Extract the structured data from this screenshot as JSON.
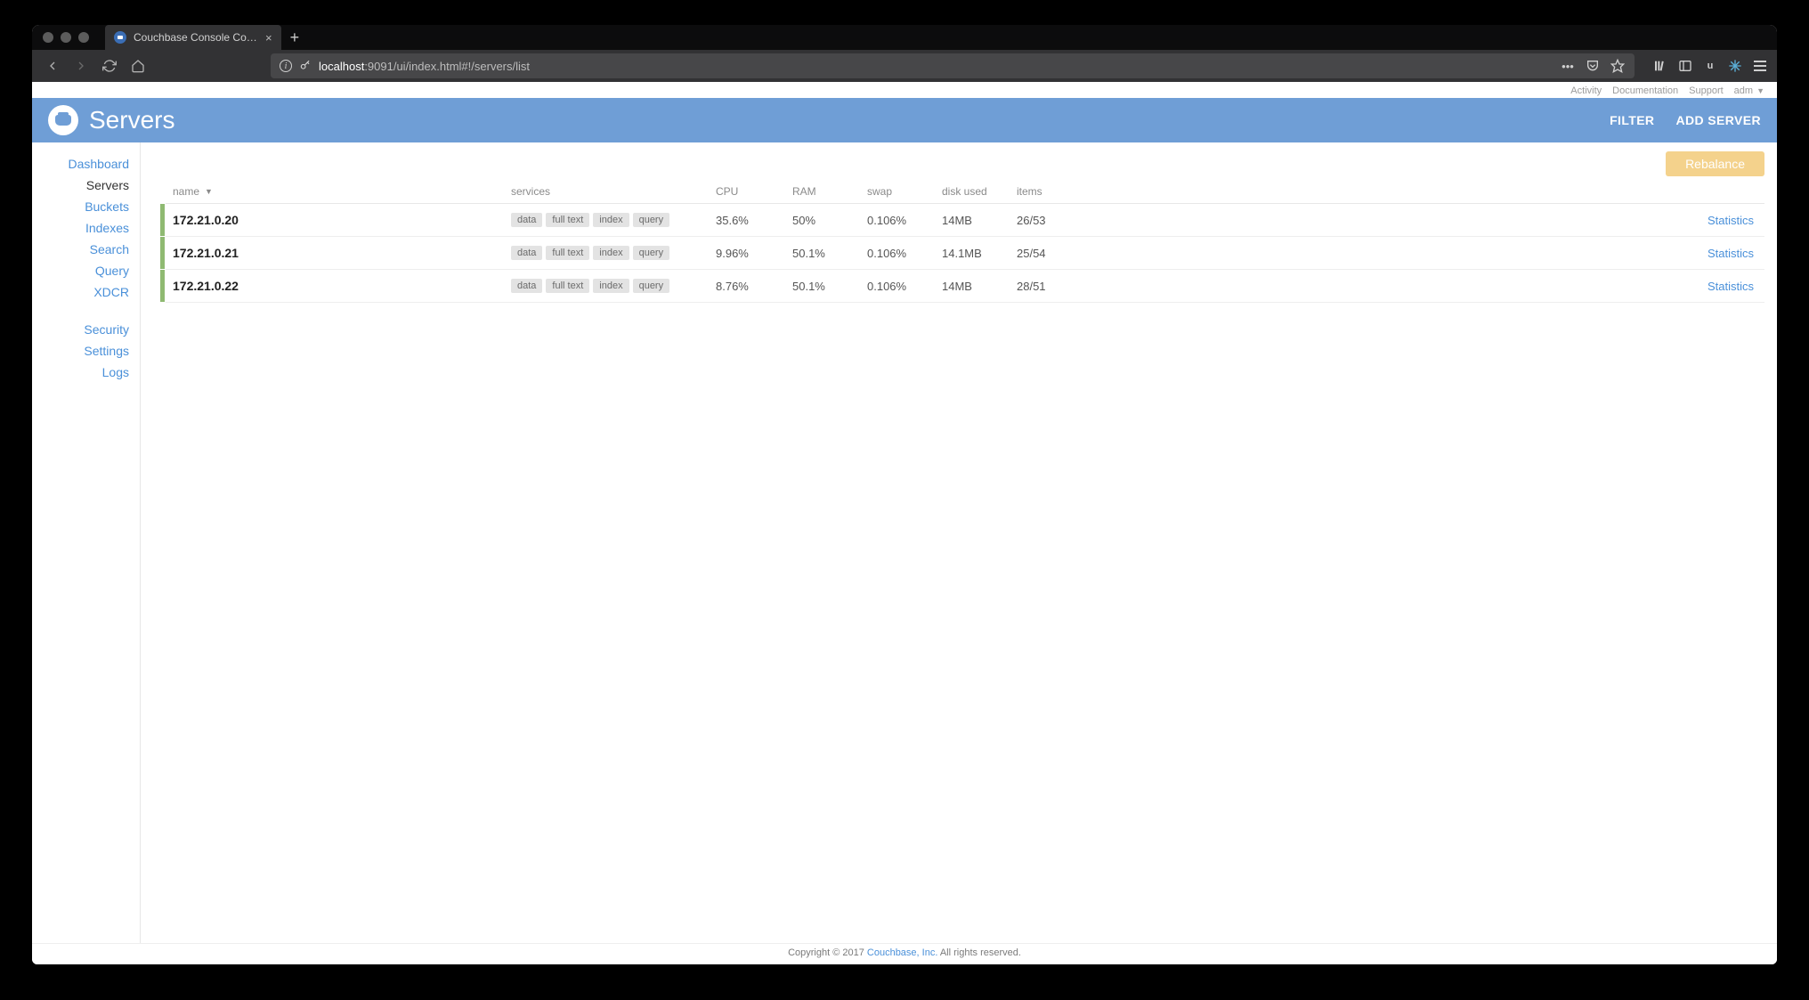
{
  "browser": {
    "tab_title": "Couchbase Console Communit",
    "url_host": "localhost",
    "url_rest": ":9091/ui/index.html#!/servers/list"
  },
  "topstrip": {
    "activity": "Activity",
    "documentation": "Documentation",
    "support": "Support",
    "user": "adm"
  },
  "header": {
    "title": "Servers",
    "filter": "FILTER",
    "add_server": "ADD SERVER"
  },
  "sidebar": {
    "group1": [
      "Dashboard",
      "Servers",
      "Buckets",
      "Indexes",
      "Search",
      "Query",
      "XDCR"
    ],
    "group2": [
      "Security",
      "Settings",
      "Logs"
    ],
    "active": "Servers"
  },
  "actions": {
    "rebalance": "Rebalance"
  },
  "columns": {
    "name": "name",
    "services": "services",
    "cpu": "CPU",
    "ram": "RAM",
    "swap": "swap",
    "disk": "disk used",
    "items": "items",
    "stats": "Statistics"
  },
  "service_tags": [
    "data",
    "full text",
    "index",
    "query"
  ],
  "servers": [
    {
      "name": "172.21.0.20",
      "cpu": "35.6%",
      "ram": "50%",
      "swap": "0.106%",
      "disk": "14MB",
      "items": "26/53"
    },
    {
      "name": "172.21.0.21",
      "cpu": "9.96%",
      "ram": "50.1%",
      "swap": "0.106%",
      "disk": "14.1MB",
      "items": "25/54"
    },
    {
      "name": "172.21.0.22",
      "cpu": "8.76%",
      "ram": "50.1%",
      "swap": "0.106%",
      "disk": "14MB",
      "items": "28/51"
    }
  ],
  "footer": {
    "prefix": "Copyright © 2017 ",
    "link": "Couchbase, Inc.",
    "suffix": " All rights reserved."
  }
}
